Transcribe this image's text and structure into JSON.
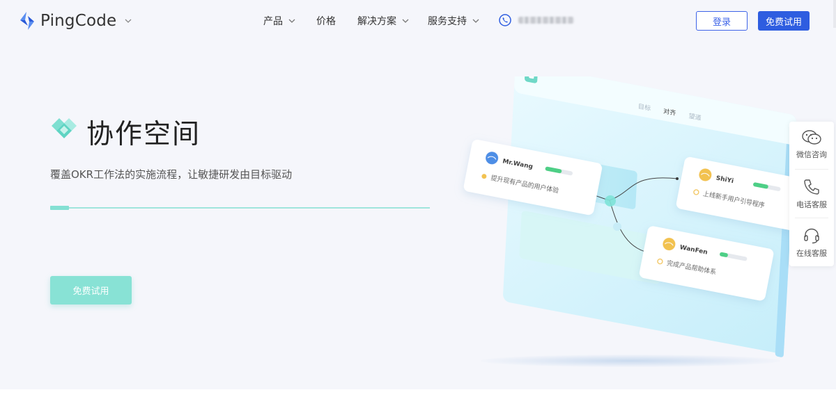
{
  "header": {
    "brand": "PingCode",
    "nav": [
      {
        "label": "产品",
        "has_dropdown": true
      },
      {
        "label": "价格",
        "has_dropdown": false
      },
      {
        "label": "解决方案",
        "has_dropdown": true
      },
      {
        "label": "服务支持",
        "has_dropdown": true
      }
    ],
    "login_label": "登录",
    "trial_label": "免费试用"
  },
  "hero": {
    "title": "协作空间",
    "subtitle": "覆盖OKR工作法的实施流程，让敏捷研发由目标驱动",
    "progress": 0.05,
    "trial_label": "免费试用"
  },
  "illustration": {
    "tabs": [
      "目标",
      "对齐",
      "望道"
    ],
    "cards": [
      {
        "name": "Mr.Wang",
        "task": "提升现有产品的用户体验",
        "progress": 0.6,
        "status_color": "#f2c24f"
      },
      {
        "name": "ShiYi",
        "task": "上线新手用户引导程序",
        "progress": 0.55,
        "status_color": "#f2c24f"
      },
      {
        "name": "WanFen",
        "task": "完成产品帮助体系",
        "progress": 0.3,
        "status_color": "#f2c24f"
      }
    ]
  },
  "side_panel": {
    "items": [
      {
        "label": "微信咨询",
        "icon": "wechat-icon"
      },
      {
        "label": "电话客服",
        "icon": "phone-icon"
      },
      {
        "label": "在线客服",
        "icon": "headset-icon"
      }
    ]
  },
  "colors": {
    "brand_blue": "#2e5de0",
    "accent_teal": "#84e0d3",
    "progress_green": "#4ecf86"
  }
}
